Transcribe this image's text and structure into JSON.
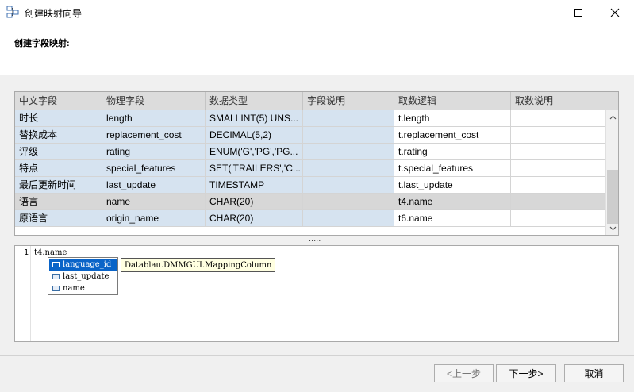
{
  "window": {
    "title": "创建映射向导"
  },
  "header": {
    "label": "创建字段映射:"
  },
  "grid": {
    "columns": [
      "中文字段",
      "物理字段",
      "数据类型",
      "字段说明",
      "取数逻辑",
      "取数说明"
    ],
    "rows": [
      [
        "时长",
        "length",
        "SMALLINT(5) UNS...",
        "",
        "t.length",
        ""
      ],
      [
        "替换成本",
        "replacement_cost",
        "DECIMAL(5,2)",
        "",
        "t.replacement_cost",
        ""
      ],
      [
        "评级",
        "rating",
        "ENUM('G','PG','PG...",
        "",
        "t.rating",
        ""
      ],
      [
        "特点",
        "special_features",
        "SET('TRAILERS','C...",
        "",
        "t.special_features",
        ""
      ],
      [
        "最后更新时间",
        "last_update",
        "TIMESTAMP",
        "",
        "t.last_update",
        ""
      ],
      [
        "语言",
        "name",
        "CHAR(20)",
        "",
        "t4.name",
        ""
      ],
      [
        "原语言",
        "origin_name",
        "CHAR(20)",
        "",
        "t6.name",
        ""
      ]
    ],
    "selected_row": 5
  },
  "splitter": {
    "dots": "....."
  },
  "editor": {
    "line_number": "1",
    "code": "t4.name",
    "autocomplete": [
      "language_id",
      "last_update",
      "name"
    ],
    "tooltip": "Datablau.DMMGUI.MappingColumn"
  },
  "footer": {
    "prev": "<上一步",
    "next": "下一步>",
    "cancel": "取消"
  }
}
